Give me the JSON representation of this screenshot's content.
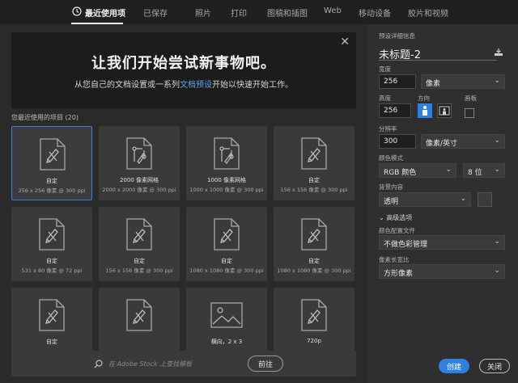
{
  "tabs": [
    {
      "label": "最近使用项",
      "active": true
    },
    {
      "label": "已保存"
    },
    {
      "label": "照片"
    },
    {
      "label": "打印"
    },
    {
      "label": "图稿和插图"
    },
    {
      "label": "Web"
    },
    {
      "label": "移动设备"
    },
    {
      "label": "胶片和视频"
    }
  ],
  "banner": {
    "title": "让我们开始尝试新事物吧。",
    "subtitle_before": "从您自己的文档设置或一系列",
    "subtitle_link": "文档预设",
    "subtitle_after": "开始以快速开始工作。",
    "close_glyph": "✕"
  },
  "recent": {
    "label": "您最近使用的项目",
    "count": "(20)",
    "items": [
      {
        "name": "自定",
        "dims": "256 x 256 像素 @ 300 ppi",
        "icon": "custom-doc-icon",
        "selected": true
      },
      {
        "name": "2000 像素网格",
        "dims": "2000 x 2000 像素 @ 300 ppi",
        "icon": "grid-doc-icon"
      },
      {
        "name": "1000 像素网格",
        "dims": "1000 x 1000 像素 @ 300 ppi",
        "icon": "grid-doc-icon"
      },
      {
        "name": "自定",
        "dims": "156 x 156 像素 @ 300 ppi",
        "icon": "custom-doc-icon"
      },
      {
        "name": "自定",
        "dims": "531 x 80 像素 @ 72 ppi",
        "icon": "custom-doc-icon"
      },
      {
        "name": "自定",
        "dims": "156 x 156 像素 @ 300 ppi",
        "icon": "custom-doc-icon"
      },
      {
        "name": "自定",
        "dims": "1080 x 1080 像素 @ 300 ppi",
        "icon": "custom-doc-icon"
      },
      {
        "name": "自定",
        "dims": "1080 x 1080 像素 @ 300 ppi",
        "icon": "custom-doc-icon"
      },
      {
        "name": "自定",
        "dims": "",
        "icon": "custom-doc-icon"
      },
      {
        "name": "",
        "dims": "",
        "icon": "custom-doc-icon"
      },
      {
        "name": "横向，2 x 3",
        "dims": "",
        "icon": "image-doc-icon"
      },
      {
        "name": "720p",
        "dims": "",
        "icon": "custom-doc-icon"
      }
    ]
  },
  "search": {
    "placeholder": "在 Adobe Stock 上查找模板",
    "go_label": "前往"
  },
  "details": {
    "header": "预设详细信息",
    "doc_name": "未标题-2",
    "width_label": "宽度",
    "width_value": "256",
    "width_unit": "像素",
    "height_label": "高度",
    "height_value": "256",
    "orientation_label": "方向",
    "artboard_label": "画板",
    "resolution_label": "分辨率",
    "resolution_value": "300",
    "resolution_unit": "像素/英寸",
    "color_mode_label": "颜色模式",
    "color_mode_value": "RGB 颜色",
    "bit_depth": "8 位",
    "background_label": "背景内容",
    "background_value": "透明",
    "advanced_label": "高级选项",
    "profile_label": "颜色配置文件",
    "profile_value": "不做色彩管理",
    "aspect_label": "像素长宽比",
    "aspect_value": "方形像素",
    "chevron": "⌄",
    "adv_chevron": "⌄"
  },
  "footer": {
    "create_label": "创建",
    "close_label": "关闭"
  },
  "colors": {
    "accent": "#2e81e0",
    "link": "#5fa4ea"
  }
}
